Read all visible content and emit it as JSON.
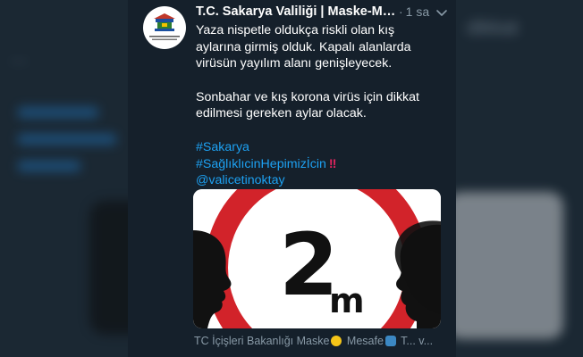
{
  "tweet": {
    "author_name": "T.C. Sakarya Valiliği | Maske-Me...",
    "separator": "·",
    "timestamp": "1 sa",
    "lines": [
      "Yaza nispetle oldukça riskli olan kış",
      "aylarına girmiş olduk. Kapalı alanlarda",
      "virüsün yayılım alanı genişleyecek."
    ],
    "lines2": [
      "Sonbahar ve kış korona virüs için dikkat",
      "edilmesi gereken aylar olacak."
    ],
    "hashtags": [
      "#Sakarya",
      "#SağlıklıcinHepimizİcin"
    ],
    "double_exclamation": "‼",
    "mention": "@valicetinoktay",
    "media": {
      "sign_number": "2",
      "sign_unit": "m",
      "colors": {
        "ring": "#d2232a",
        "silhouette": "#111111",
        "background": "#ffffff"
      }
    },
    "card_text_a": "TC İçişleri Bakanlığı Maske",
    "card_text_b": " Mesafe",
    "card_text_c": " T... v..."
  },
  "background": {
    "ghost_right_text": "dikkat"
  },
  "icons": [
    "avatar-emblem",
    "caret-down-icon",
    "grimace-emoji-icon",
    "left-right-arrow-icon"
  ],
  "colors": {
    "page_bg": "#15202b",
    "text_primary": "#ffffff",
    "text_secondary": "#8899a6",
    "link": "#1da1f2"
  }
}
